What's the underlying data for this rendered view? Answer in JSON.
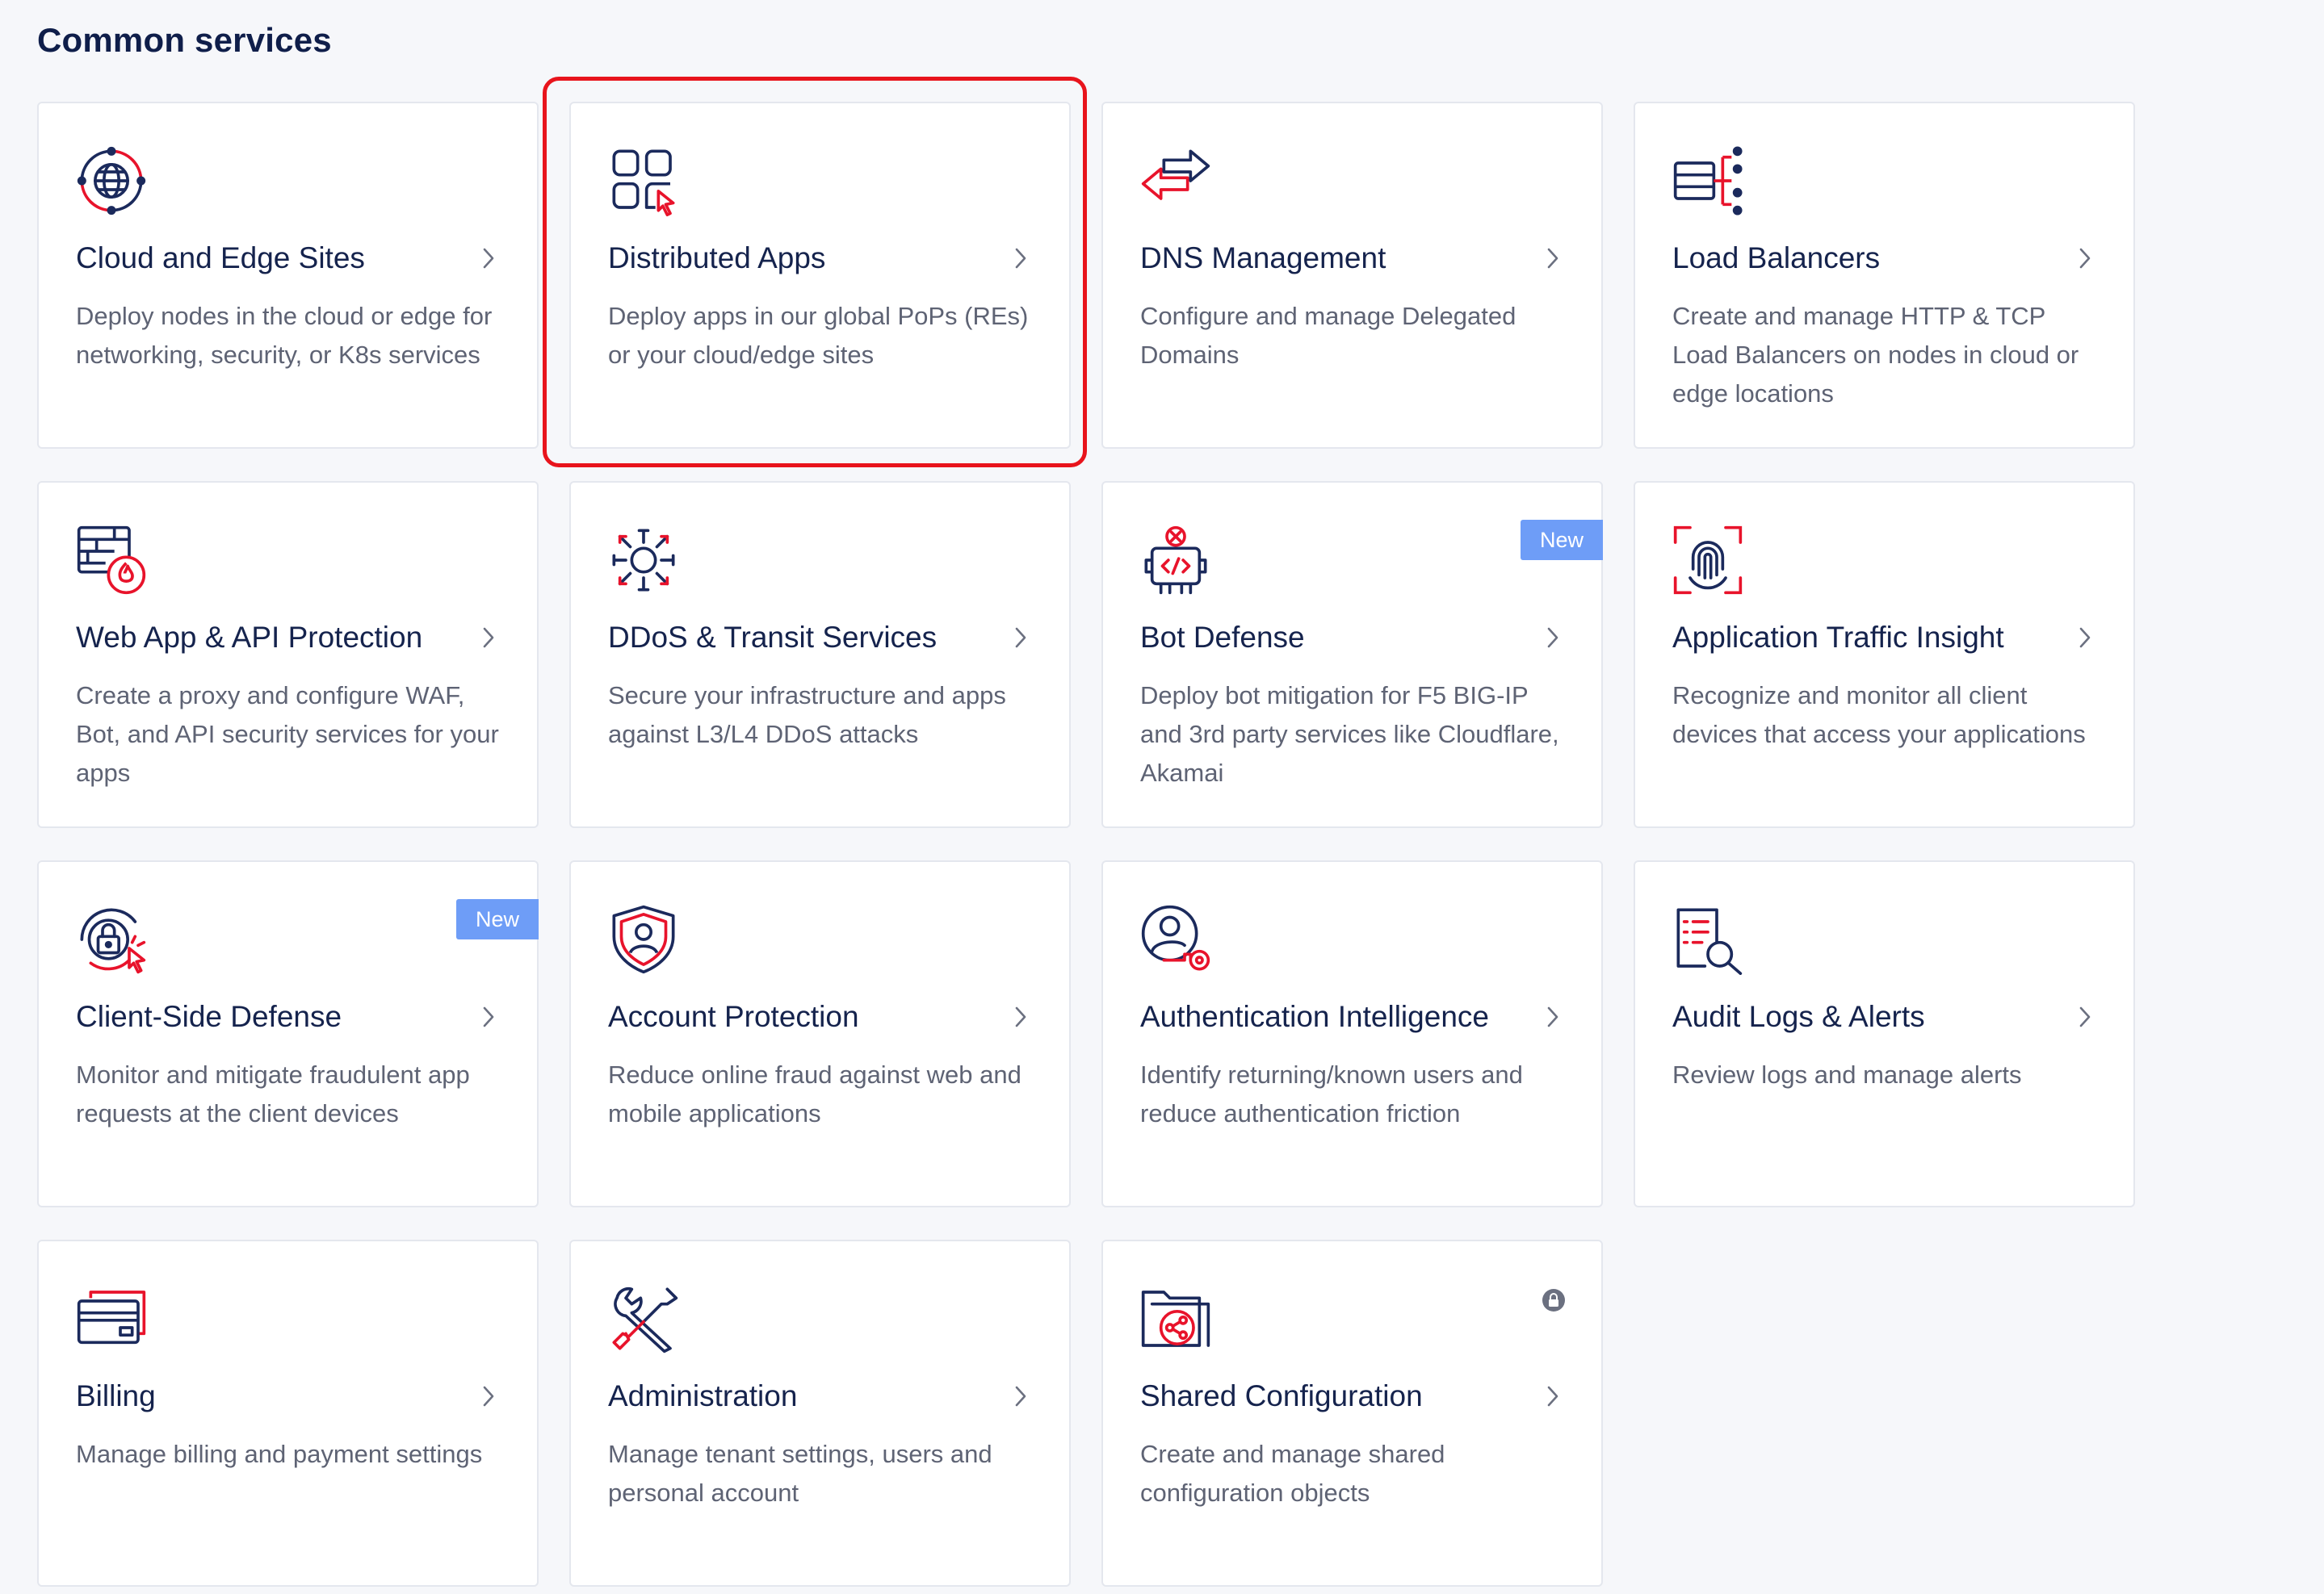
{
  "section": {
    "title": "Common services"
  },
  "colors": {
    "navy": "#1b2a5c",
    "red": "#e8132b",
    "badge": "#6e9df7",
    "highlight": "#e8141c"
  },
  "cards": [
    {
      "title": "Cloud and Edge Sites",
      "desc": "Deploy nodes in the cloud or edge for networking, security, or K8s services",
      "icon": "globe-network-icon"
    },
    {
      "title": "Distributed Apps",
      "desc": "Deploy apps in our global PoPs (REs) or your cloud/edge sites",
      "icon": "app-grid-icon"
    },
    {
      "title": "DNS Management",
      "desc": "Configure and manage Delegated Domains",
      "icon": "dns-arrows-icon"
    },
    {
      "title": "Load Balancers",
      "desc": "Create and manage HTTP & TCP Load Balancers on nodes in cloud or edge locations",
      "icon": "load-balancer-icon"
    },
    {
      "title": "Web App & API Protection",
      "desc": "Create a proxy and configure WAF, Bot, and API security services for your apps",
      "icon": "firewall-fire-icon"
    },
    {
      "title": "DDoS & Transit Services",
      "desc": "Secure your infrastructure and apps against L3/L4 DDoS attacks",
      "icon": "ddos-burst-icon"
    },
    {
      "title": "Bot Defense",
      "desc": "Deploy bot mitigation for F5 BIG-IP and 3rd party services like Cloudflare, Akamai",
      "icon": "bot-code-icon",
      "badge": "New"
    },
    {
      "title": "Application Traffic Insight",
      "desc": "Recognize and monitor all client devices that access your applications",
      "icon": "fingerprint-scan-icon"
    },
    {
      "title": "Client-Side Defense",
      "desc": "Monitor and mitigate fraudulent app requests at the client devices",
      "icon": "client-lock-icon",
      "badge": "New"
    },
    {
      "title": "Account Protection",
      "desc": "Reduce online fraud against web and mobile applications",
      "icon": "shield-user-icon"
    },
    {
      "title": "Authentication Intelligence",
      "desc": "Identify returning/known users and reduce authentication friction",
      "icon": "user-key-icon"
    },
    {
      "title": "Audit Logs & Alerts",
      "desc": "Review logs and manage alerts",
      "icon": "log-search-icon"
    },
    {
      "title": "Billing",
      "desc": "Manage billing and payment settings",
      "icon": "credit-card-icon"
    },
    {
      "title": "Administration",
      "desc": "Manage tenant settings, users and personal account",
      "icon": "wrench-screwdriver-icon"
    },
    {
      "title": "Shared Configuration",
      "desc": "Create and manage shared configuration objects",
      "icon": "shared-folder-icon",
      "lock": true
    }
  ]
}
